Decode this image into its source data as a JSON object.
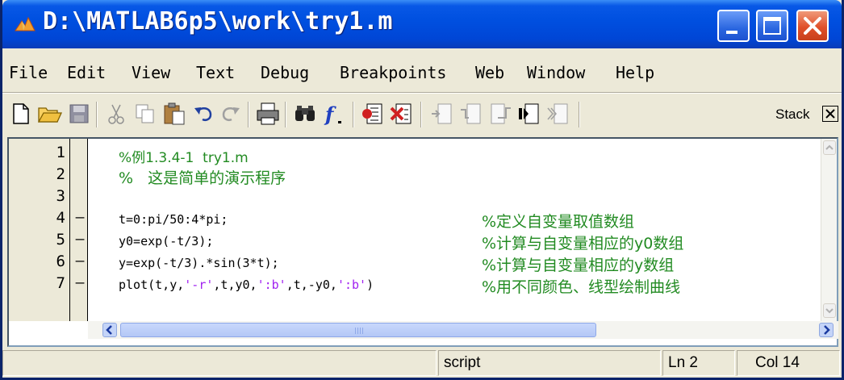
{
  "window": {
    "title": "D:\\MATLAB6p5\\work\\try1.m"
  },
  "menu": {
    "items": [
      "File",
      "Edit",
      "View",
      "Text",
      "Debug",
      "Breakpoints",
      "Web",
      "Window",
      "Help"
    ]
  },
  "toolbar": {
    "icons": [
      "new-file-icon",
      "open-folder-icon",
      "save-icon",
      "cut-icon",
      "copy-icon",
      "paste-icon",
      "undo-icon",
      "redo-icon",
      "print-icon",
      "find-icon",
      "function-icon",
      "set-breakpoint-icon",
      "clear-breakpoints-icon",
      "step-icon",
      "step-in-icon",
      "step-out-icon",
      "continue-icon",
      "exit-debug-icon"
    ],
    "stack_label": "Stack",
    "stack_close": "X"
  },
  "editor": {
    "lines": [
      {
        "num": "1",
        "mark": "",
        "code": "%例1.3.4-1  try1.m",
        "comment": ""
      },
      {
        "num": "2",
        "mark": "",
        "code": "%   这是简单的演示程序",
        "comment": ""
      },
      {
        "num": "3",
        "mark": "",
        "code": "",
        "comment": ""
      },
      {
        "num": "4",
        "mark": "–",
        "code": "t=0:pi/50:4*pi;",
        "comment": "%定义自变量取值数组"
      },
      {
        "num": "5",
        "mark": "–",
        "code": "y0=exp(-t/3);",
        "comment": "%计算与自变量相应的y0数组"
      },
      {
        "num": "6",
        "mark": "–",
        "code": "y=exp(-t/3).*sin(3*t);",
        "comment": "%计算与自变量相应的y数组"
      },
      {
        "num": "7",
        "mark": "–",
        "code_parts": [
          "plot(t,y,",
          "'-r'",
          ",t,y0,",
          "':b'",
          ",t,-y0,",
          "':b'",
          ")"
        ],
        "comment": "%用不同颜色、线型绘制曲线"
      }
    ]
  },
  "status": {
    "mode": "script",
    "line": "Ln 2",
    "col": "Col 14"
  },
  "colors": {
    "title_bar": "#0050e0",
    "comment": "#228b22",
    "string": "#a020f0",
    "chrome": "#ece9d8"
  }
}
